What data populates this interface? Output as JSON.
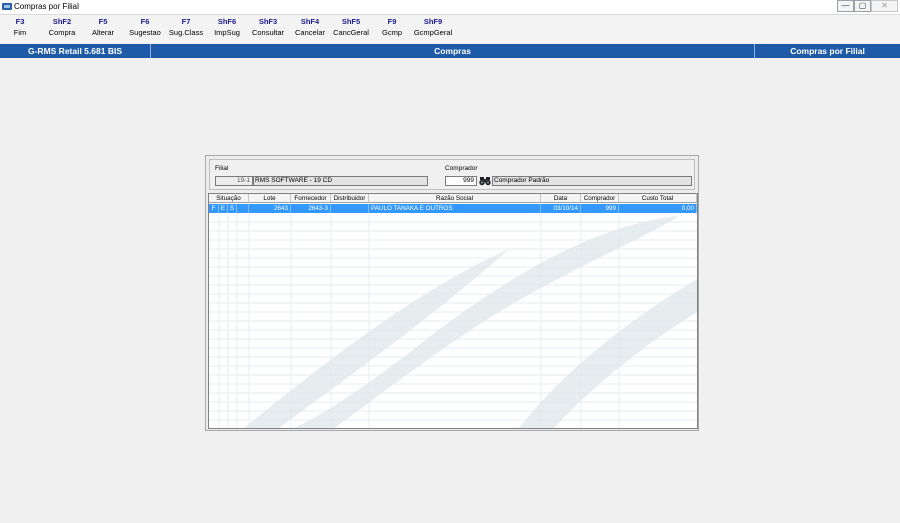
{
  "window": {
    "title": "Compras por Filial",
    "min_glyph": "—",
    "max_glyph": "▢",
    "close_glyph": "✕"
  },
  "toolbar": {
    "items": [
      {
        "key": "F3",
        "label": "Fim"
      },
      {
        "key": "ShF2",
        "label": "Compra"
      },
      {
        "key": "F5",
        "label": "Alterar"
      },
      {
        "key": "F6",
        "label": "Sugestao"
      },
      {
        "key": "F7",
        "label": "Sug.Class"
      },
      {
        "key": "ShF6",
        "label": "ImpSug"
      },
      {
        "key": "ShF3",
        "label": "Consultar"
      },
      {
        "key": "ShF4",
        "label": "Cancelar"
      },
      {
        "key": "ShF5",
        "label": "CancGeral"
      },
      {
        "key": "F9",
        "label": "Gcmp"
      },
      {
        "key": "ShF9",
        "label": "GcmpGeral"
      }
    ]
  },
  "statusbar": {
    "left": "G-RMS Retail 5.681 BIS",
    "center": "Compras",
    "right": "Compras por Filial"
  },
  "filter": {
    "filial_label": "Filial",
    "filial_code": "19-1",
    "filial_name": "RMS SOFTWARE  - 19 CD",
    "comprador_label": "Comprador",
    "comprador_code": "999",
    "comprador_name": "Comprador Padrão"
  },
  "grid": {
    "headers": {
      "situacao": "Situação",
      "lote": "Lote",
      "fornecedor": "Fornecedor",
      "distribuidor": "Distribuidor",
      "razao_social": "Razão Social",
      "data": "Data",
      "comprador": "Comprador",
      "custo_total": "Custo Total"
    },
    "rows": [
      {
        "f": "F",
        "e": "E",
        "s": "S",
        "lote": "2643",
        "fornecedor": "2643-3",
        "distribuidor": "",
        "razao_social": "PAULO TANAKA E OUTROS",
        "data": "03/10/14",
        "comprador": "999",
        "custo_total": "0,00"
      }
    ]
  },
  "colors": {
    "statusbar": "#1f5aa8",
    "selection": "#3399ff",
    "function_key": "#1a1a8a"
  }
}
